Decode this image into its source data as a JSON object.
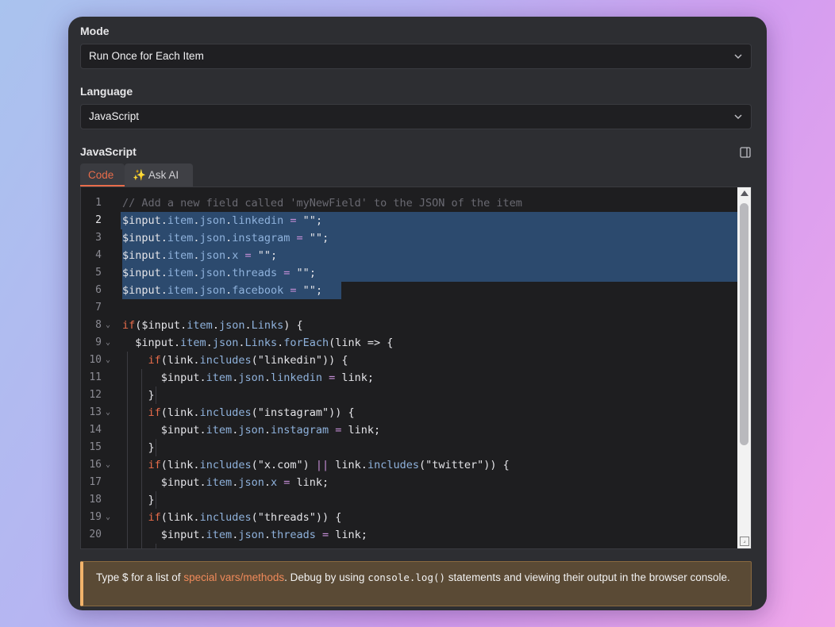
{
  "mode": {
    "label": "Mode",
    "value": "Run Once for Each Item"
  },
  "language": {
    "label": "Language",
    "value": "JavaScript"
  },
  "editor_section": {
    "label": "JavaScript"
  },
  "tabs": {
    "code": "Code",
    "ask_ai": "✨ Ask AI"
  },
  "code_lines": [
    {
      "n": "1",
      "text": "// Add a new field called 'myNewField' to the JSON of the item"
    },
    {
      "n": "2",
      "text": "$input.item.json.linkedin = \"\";"
    },
    {
      "n": "3",
      "text": "$input.item.json.instagram = \"\";"
    },
    {
      "n": "4",
      "text": "$input.item.json.x = \"\";"
    },
    {
      "n": "5",
      "text": "$input.item.json.threads = \"\";"
    },
    {
      "n": "6",
      "text": "$input.item.json.facebook = \"\";"
    },
    {
      "n": "7",
      "text": ""
    },
    {
      "n": "8",
      "text": "if($input.item.json.Links) {"
    },
    {
      "n": "9",
      "text": "  $input.item.json.Links.forEach(link => {"
    },
    {
      "n": "10",
      "text": "    if(link.includes(\"linkedin\")) {"
    },
    {
      "n": "11",
      "text": "      $input.item.json.linkedin = link;"
    },
    {
      "n": "12",
      "text": "    }"
    },
    {
      "n": "13",
      "text": "    if(link.includes(\"instagram\")) {"
    },
    {
      "n": "14",
      "text": "      $input.item.json.instagram = link;"
    },
    {
      "n": "15",
      "text": "    }"
    },
    {
      "n": "16",
      "text": "    if(link.includes(\"x.com\") || link.includes(\"twitter\")) {"
    },
    {
      "n": "17",
      "text": "      $input.item.json.x = link;"
    },
    {
      "n": "18",
      "text": "    }"
    },
    {
      "n": "19",
      "text": "    if(link.includes(\"threads\")) {"
    },
    {
      "n": "20",
      "text": "      $input.item.json.threads = link;"
    }
  ],
  "hint": {
    "prefix": "Type $ for a list of ",
    "link": "special vars/methods",
    "middle": ". Debug by using ",
    "code": "console.log()",
    "suffix": " statements and viewing their output in the browser console."
  }
}
